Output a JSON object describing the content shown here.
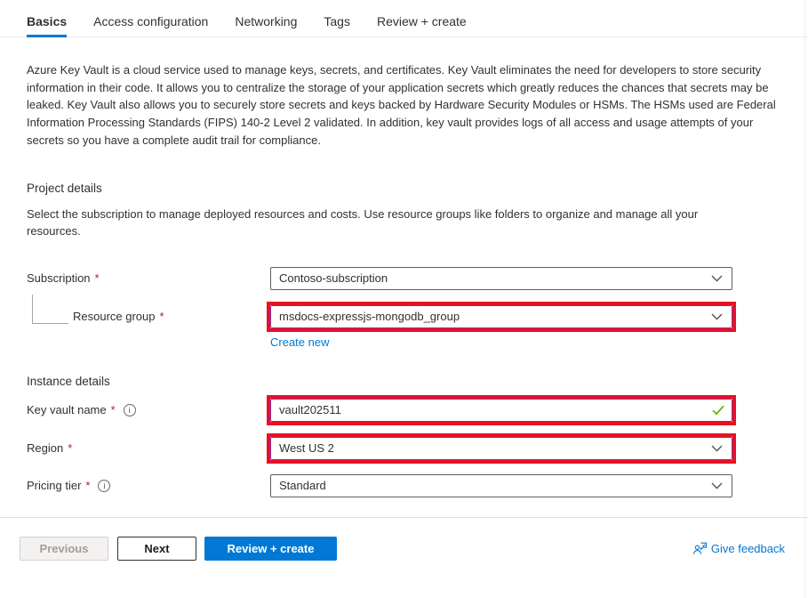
{
  "tabs": [
    {
      "label": "Basics",
      "active": true
    },
    {
      "label": "Access configuration",
      "active": false
    },
    {
      "label": "Networking",
      "active": false
    },
    {
      "label": "Tags",
      "active": false
    },
    {
      "label": "Review + create",
      "active": false
    }
  ],
  "intro": "Azure Key Vault is a cloud service used to manage keys, secrets, and certificates. Key Vault eliminates the need for developers to store security information in their code. It allows you to centralize the storage of your application secrets which greatly reduces the chances that secrets may be leaked. Key Vault also allows you to securely store secrets and keys backed by Hardware Security Modules or HSMs. The HSMs used are Federal Information Processing Standards (FIPS) 140-2 Level 2 validated. In addition, key vault provides logs of all access and usage attempts of your secrets so you have a complete audit trail for compliance.",
  "project_details": {
    "heading": "Project details",
    "description": "Select the subscription to manage deployed resources and costs. Use resource groups like folders to organize and manage all your resources.",
    "subscription": {
      "label": "Subscription",
      "required": "*",
      "value": "Contoso-subscription"
    },
    "resource_group": {
      "label": "Resource group",
      "required": "*",
      "value": "msdocs-expressjs-mongodb_group",
      "create_new_label": "Create new"
    }
  },
  "instance_details": {
    "heading": "Instance details",
    "key_vault_name": {
      "label": "Key vault name",
      "required": "*",
      "value": "vault202511"
    },
    "region": {
      "label": "Region",
      "required": "*",
      "value": "West US 2"
    },
    "pricing_tier": {
      "label": "Pricing tier",
      "required": "*",
      "value": "Standard"
    }
  },
  "footer": {
    "previous_label": "Previous",
    "next_label": "Next",
    "review_create_label": "Review + create",
    "feedback_label": "Give feedback"
  },
  "icons": {
    "info_glyph": "i"
  },
  "colors": {
    "accent_blue": "#0078d4",
    "annotation_red": "#e81123",
    "focus_purple": "#8a2da5",
    "valid_green": "#5db300",
    "required_red": "#a4262c",
    "text": "#323130"
  }
}
